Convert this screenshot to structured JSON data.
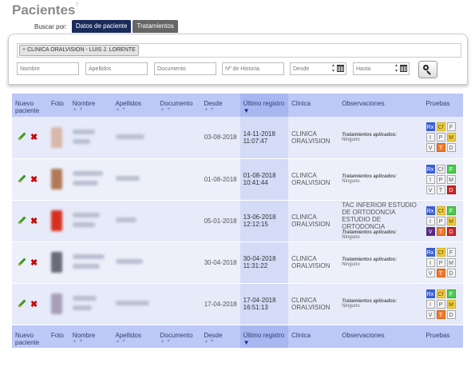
{
  "page": {
    "title": "Pacientes",
    "title_sup": "?"
  },
  "search": {
    "label": "Buscar por:",
    "tabs": [
      "Datos de paciente",
      "Tratamientos"
    ],
    "chip": "CLINICA ORALVISION - LUIS J. LORENTE",
    "chip_remove": "×",
    "placeholders": {
      "nombre": "Nombre",
      "apellidos": "Apellidos",
      "documento": "Documento",
      "historia": "Nº de Historia",
      "desde": "Desde",
      "hasta": "Hasta"
    }
  },
  "table": {
    "headers": {
      "nuevo": "Nuevo paciente",
      "foto": "Foto",
      "nombre": "Nombre",
      "apellidos": "Apellidos",
      "documento": "Documento",
      "desde": "Desde",
      "ultimo": "Último registro",
      "clinica": "Clinica",
      "observaciones": "Observaciones",
      "pruebas": "Pruebas"
    },
    "sort_both": "▲ ▼",
    "sort_active": "▼",
    "obs_label": "Tratamientos aplicados:",
    "rows": [
      {
        "desde": "03-08-2018",
        "ultimo_fecha": "14-11-2018",
        "ultimo_hora": "11:07:47",
        "clinica": "CLINICA ORALVISION",
        "obs_text": "",
        "tratamientos": "Ninguno"
      },
      {
        "desde": "01-08-2018",
        "ultimo_fecha": "01-08-2018",
        "ultimo_hora": "10:41:44",
        "clinica": "CLINICA ORALVISION",
        "obs_text": "",
        "tratamientos": "Ninguno"
      },
      {
        "desde": "05-01-2018",
        "ultimo_fecha": "13-06-2018",
        "ultimo_hora": "12:12:15",
        "clinica": "CLINICA ORALVISION",
        "obs_text": "TAC INFERIOR ESTUDIO DE ORTODONCIA ESTUDIO DE ORTODONCIA",
        "tratamientos": "Ninguno"
      },
      {
        "desde": "30-04-2018",
        "ultimo_fecha": "30-04-2018",
        "ultimo_hora": "11:31:22",
        "clinica": "CLINICA ORALVISION",
        "obs_text": "",
        "tratamientos": "Ninguno"
      },
      {
        "desde": "17-04-2018",
        "ultimo_fecha": "17-04-2018",
        "ultimo_hora": "16:51:13",
        "clinica": "CLINICA ORALVISION",
        "obs_text": "",
        "tratamientos": "Ninguno"
      }
    ],
    "pruebas_labels": [
      "Rx",
      "Cf",
      "F",
      "I",
      "P",
      "M",
      "V",
      "T",
      "D"
    ],
    "pruebas_states": [
      [
        "blue",
        "yellow",
        "none",
        "none",
        "none",
        "yellow",
        "none",
        "orange",
        "none"
      ],
      [
        "blue",
        "none",
        "green",
        "none",
        "none",
        "none",
        "none",
        "none",
        "red"
      ],
      [
        "blue",
        "yellow",
        "green",
        "none",
        "none",
        "yellow",
        "purple",
        "orange",
        "red"
      ],
      [
        "blue",
        "yellow",
        "none",
        "none",
        "none",
        "none",
        "none",
        "orange",
        "none"
      ],
      [
        "blue",
        "yellow",
        "green",
        "none",
        "none",
        "yellow",
        "none",
        "orange",
        "none"
      ]
    ],
    "photo_colors": [
      "#d8b8a8",
      "#b07a5a",
      "#d83020",
      "#6a6a78",
      "#a8a0b8"
    ]
  }
}
